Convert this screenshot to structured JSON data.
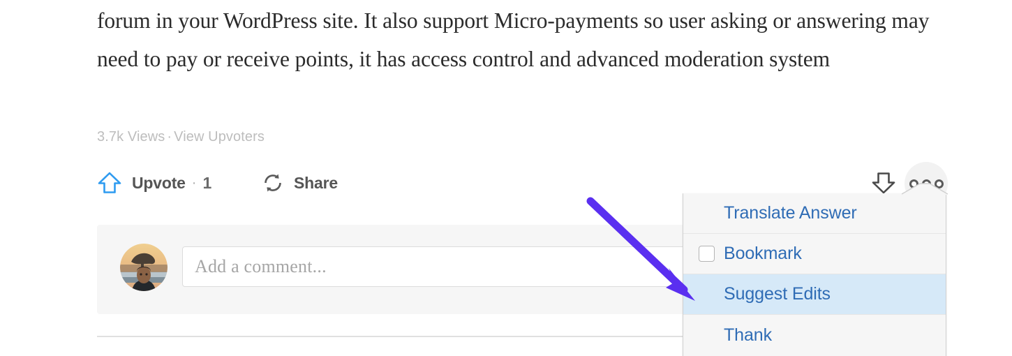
{
  "answer": {
    "body_text": "forum in your WordPress site. It also support Micro-payments so user asking or answering may need to pay or receive points, it has access control and advanced moderation system",
    "views": "3.7k Views",
    "separator": "·",
    "view_upvoters": "View Upvoters"
  },
  "actions": {
    "upvote_label": "Upvote",
    "upvote_separator": "·",
    "upvote_count": "1",
    "share_label": "Share",
    "upvote_icon": "upvote-arrow-icon",
    "share_icon": "share-refresh-icon",
    "downvote_icon": "downvote-arrow-icon",
    "forward_icon": "forward-arrow-icon",
    "more_icon": "more-options-icon"
  },
  "comment": {
    "placeholder": "Add a comment...",
    "avatar_alt": "user-avatar"
  },
  "menu": {
    "items": [
      {
        "label": "Translate Answer",
        "has_checkbox": false,
        "highlighted": false
      },
      {
        "label": "Bookmark",
        "has_checkbox": true,
        "highlighted": false
      },
      {
        "label": "Suggest Edits",
        "has_checkbox": false,
        "highlighted": true
      },
      {
        "label": "Thank",
        "has_checkbox": false,
        "highlighted": false
      }
    ]
  },
  "annotation": {
    "type": "arrow",
    "points_to": "Suggest Edits",
    "color": "#5a2ff0"
  },
  "colors": {
    "upvote_blue": "#2e9bf0",
    "menu_link_blue": "#2f6cb5",
    "menu_highlight": "#d6e9f8",
    "meta_gray": "#bdbdbd",
    "comment_bg": "#f6f6f6",
    "annotation_purple": "#5a2ff0"
  }
}
